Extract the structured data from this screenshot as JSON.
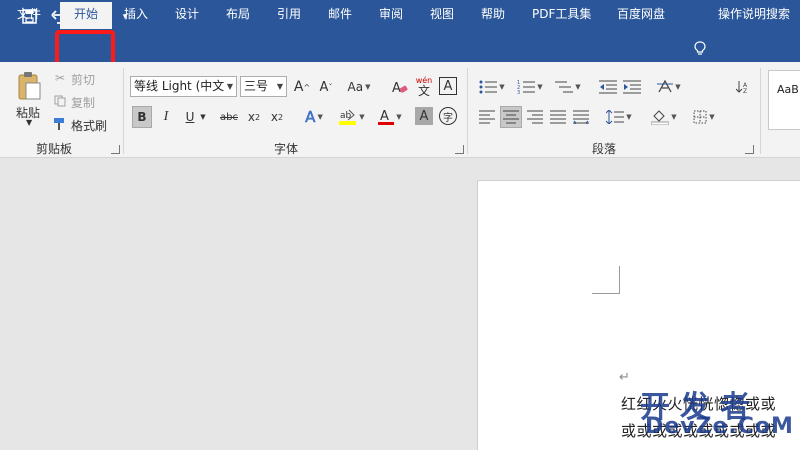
{
  "ribbon_tabs": [
    {
      "label": "文件"
    },
    {
      "label": "开始"
    },
    {
      "label": "插入"
    },
    {
      "label": "设计"
    },
    {
      "label": "布局"
    },
    {
      "label": "引用"
    },
    {
      "label": "邮件"
    },
    {
      "label": "审阅"
    },
    {
      "label": "视图"
    },
    {
      "label": "帮助"
    },
    {
      "label": "PDF工具集"
    },
    {
      "label": "百度网盘"
    },
    {
      "label": "操作说明搜索"
    }
  ],
  "active_tab": "开始",
  "clipboard": {
    "paste": "粘贴",
    "cut": "剪切",
    "copy": "复制",
    "format_painter": "格式刷",
    "group": "剪贴板"
  },
  "font": {
    "name": "等线 Light (中文",
    "size": "三号",
    "change_case": "Aa",
    "phonetic_top": "wén",
    "phonetic_bottom": "文",
    "char_border": "A",
    "bold": "B",
    "italic": "I",
    "underline": "U",
    "strike": "abc",
    "enclose": "字",
    "group": "字体"
  },
  "paragraph": {
    "group": "段落"
  },
  "styles": {
    "preview": "AaB"
  },
  "document": {
    "para_mark": "↵",
    "line1": "红红火火恍恍惚惚或或",
    "line2": "或或或或或或或或或或",
    "watermark_top": "开发者",
    "watermark_bottom": "DevZe.CoM"
  },
  "colors": {
    "title_bar": "#2b579a",
    "ribbon_bg": "#f3f3f3",
    "highlight_outline": "#ff1a1a"
  }
}
